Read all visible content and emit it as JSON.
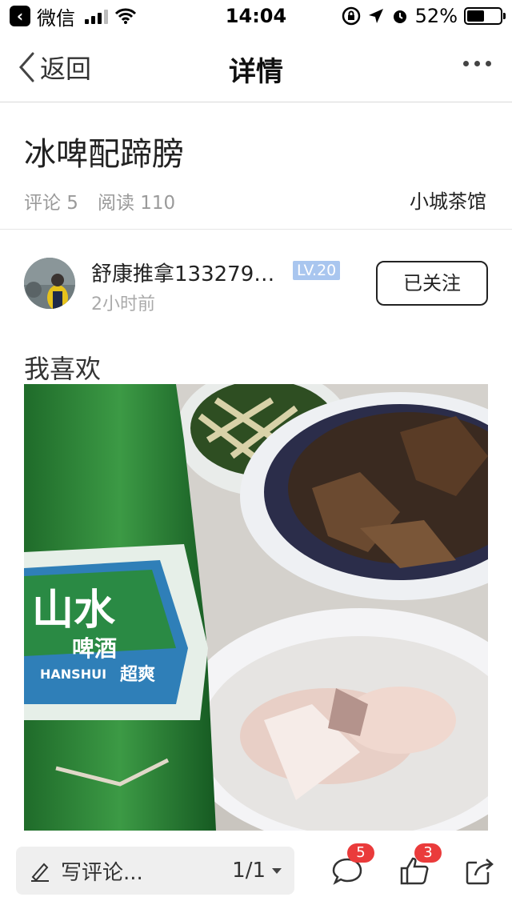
{
  "status_bar": {
    "back_app_icon": "chevron-left",
    "app_name": "微信",
    "time": "14:04",
    "battery_percent": "52%",
    "battery_level": 0.52
  },
  "nav": {
    "back_label": "返回",
    "title": "详情",
    "more_icon": "ellipsis-icon"
  },
  "article": {
    "title": "冰啤配蹄膀",
    "comments_label": "评论 5",
    "reads_label": "阅读 110",
    "channel": "小城茶馆"
  },
  "author": {
    "name": "舒康推拿133279…",
    "level": "LV.20",
    "time": "2小时前",
    "follow_label": "已关注"
  },
  "post": {
    "text": "我喜欢"
  },
  "photo_labels": {
    "brand_cn": "山水",
    "beer": "啤酒",
    "brand_en": "HANSHUI",
    "tagline": "超爽"
  },
  "bottom_bar": {
    "comment_placeholder": "写评论...",
    "page_indicator": "1/1",
    "comment_count": "5",
    "like_count": "3"
  },
  "colors": {
    "badge_red": "#ea3b3b",
    "level_badge": "#a9c6ef"
  }
}
